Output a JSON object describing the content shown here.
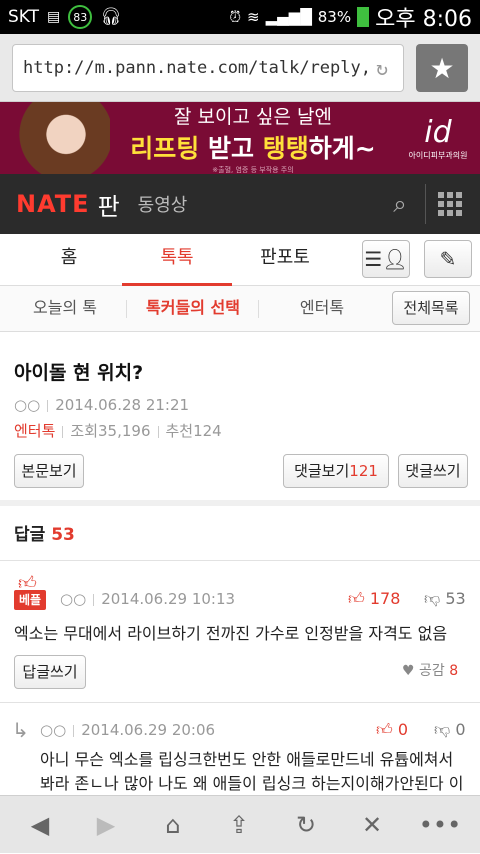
{
  "status": {
    "carrier": "SKT",
    "battery_circle": "83",
    "battery_pct": "83%",
    "time": "오후 8:06"
  },
  "browser": {
    "url": "http://m.pann.nate.com/talk/reply,"
  },
  "banner": {
    "line1": "잘 보이고 싶은 날엔",
    "line2_a": "리프팅",
    "line2_b": " 받고 ",
    "line2_c": "탱탱",
    "line2_d": "하게~",
    "fine_print": "※출혈, 염증 등 부작용 주의",
    "logo": "id",
    "logo_sub": "아이디피부과의원"
  },
  "nate": {
    "brand": "NATE",
    "pann": "판",
    "video": "동영상"
  },
  "tabs": [
    "홈",
    "톡톡",
    "판포토"
  ],
  "subtabs": [
    "오늘의 톡",
    "톡커들의 선택",
    "엔터톡"
  ],
  "all_list": "전체목록",
  "article": {
    "title": "아이돌 현 위치?",
    "author": "○○",
    "date": "2014.06.28 21:21",
    "category": "엔터톡",
    "views": "조회35,196",
    "recommends": "추천124",
    "btn_body": "본문보기",
    "btn_comments": "댓글보기",
    "comment_count": "121",
    "btn_write": "댓글쓰기"
  },
  "replies": {
    "label": "답글",
    "count": "53",
    "items": [
      {
        "badge": "베플",
        "author": "○○",
        "date": "2014.06.29 10:13",
        "up": "178",
        "down": "53",
        "text": "엑소는 무대에서 라이브하기 전까진 가수로 인정받을 자격도 없음",
        "reply_btn": "답글쓰기",
        "like_label": "공감",
        "like_count": "8"
      },
      {
        "author": "○○",
        "date": "2014.06.29 20:06",
        "up": "0",
        "down": "0",
        "text1": "아니 무슨 엑소를 립싱크한번도 안한 애들로만드네 유튭에쳐서",
        "text2": "봐라 존ㄴ나 많아 나도 왜 애들이 립싱크 하는지이해가안된다 이"
      }
    ]
  },
  "colors": {
    "accent": "#e23b2e",
    "banner": "#7a0b35",
    "navbar": "#2b2b2b"
  }
}
